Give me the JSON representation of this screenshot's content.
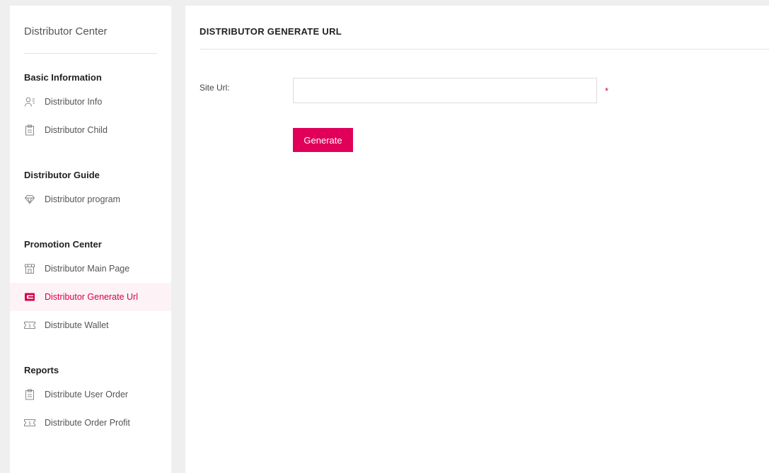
{
  "sidebar": {
    "title": "Distributor Center",
    "sections": [
      {
        "heading": "Basic Information",
        "items": [
          {
            "label": "Distributor Info",
            "icon": "user-card-icon"
          },
          {
            "label": "Distributor Child",
            "icon": "clipboard-icon"
          }
        ]
      },
      {
        "heading": "Distributor Guide",
        "items": [
          {
            "label": "Distributor program",
            "icon": "diamond-icon"
          }
        ]
      },
      {
        "heading": "Promotion Center",
        "items": [
          {
            "label": "Distributor Main Page",
            "icon": "storefront-icon"
          },
          {
            "label": "Distributor Generate Url",
            "icon": "wallet-icon",
            "active": true
          },
          {
            "label": "Distribute Wallet",
            "icon": "money-bill-icon"
          }
        ]
      },
      {
        "heading": "Reports",
        "items": [
          {
            "label": "Distribute User Order",
            "icon": "clipboard-icon"
          },
          {
            "label": "Distribute Order Profit",
            "icon": "money-bill-icon"
          }
        ]
      }
    ]
  },
  "main": {
    "title": "DISTRIBUTOR GENERATE URL",
    "form": {
      "site_url_label": "Site Url:",
      "site_url_value": "",
      "site_url_placeholder": "",
      "required_mark": "*",
      "generate_label": "Generate"
    }
  },
  "colors": {
    "accent": "#e0005a",
    "active_bg": "#fdf2f5",
    "page_bg": "#efefef"
  }
}
